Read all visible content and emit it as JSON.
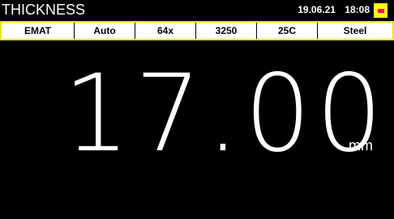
{
  "header": {
    "title": "THICKNESS",
    "date": "19.06.21",
    "time": "18:08",
    "battery_icon": "battery-icon",
    "battery_color": "#ffff00",
    "battery_level_color": "#ff0066"
  },
  "settings": [
    {
      "label": "EMAT"
    },
    {
      "label": "Auto"
    },
    {
      "label": "64x"
    },
    {
      "label": "3250"
    },
    {
      "label": "25C"
    },
    {
      "label": "Steel"
    }
  ],
  "measurement": {
    "value": "17.00",
    "unit": "mm"
  },
  "colors": {
    "background": "#000000",
    "accent": "#ffff00",
    "text": "#ffffff"
  }
}
